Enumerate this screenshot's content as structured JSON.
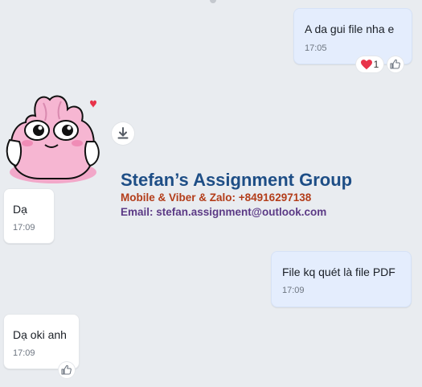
{
  "messages": [
    {
      "text": "A da gui file nha e",
      "time": "17:05",
      "reaction_count": "1"
    },
    {
      "text": "Dạ",
      "time": "17:09"
    },
    {
      "text": "File kq quét là file PDF",
      "time": "17:09"
    },
    {
      "text": "Dạ oki anh",
      "time": "17:09"
    }
  ],
  "watermark": {
    "title": "Stefan’s Assignment Group",
    "phone": "Mobile & Viber & Zalo: +84916297138",
    "email": "Email: stefan.assignment@outlook.com"
  },
  "colors": {
    "background": "#e9ecf0",
    "outgoing_bubble": "#e4edfd",
    "incoming_bubble": "#ffffff",
    "heart": "#e8334a",
    "sticker_pink": "#f6b6d2"
  },
  "icons": {
    "reaction": "heart-icon",
    "like": "thumbs-up-icon",
    "download": "download-icon"
  }
}
